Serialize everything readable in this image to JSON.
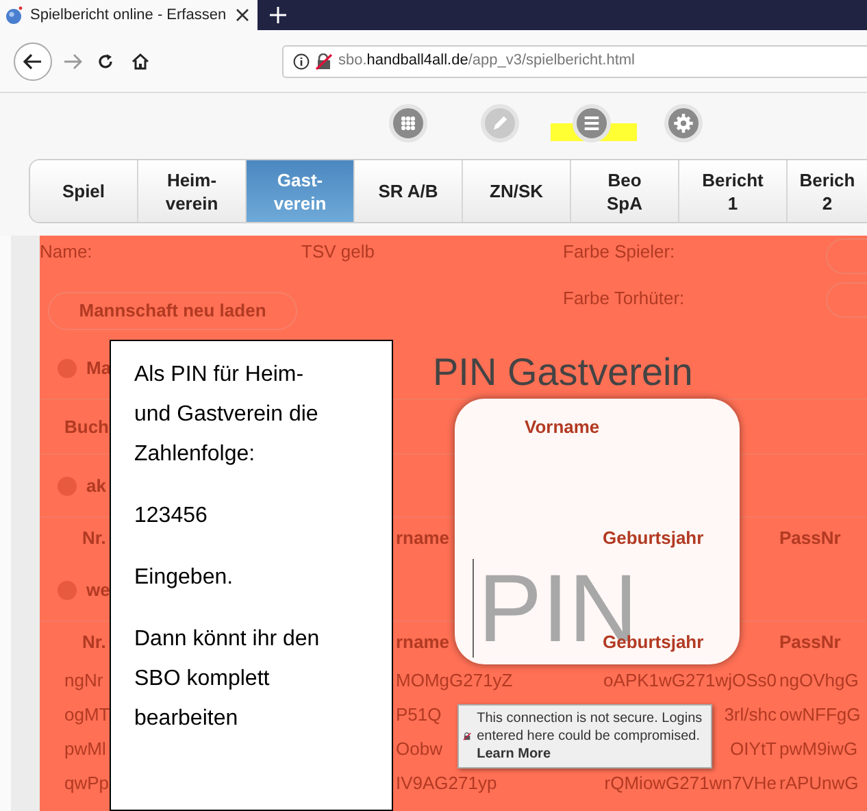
{
  "browser": {
    "tab_title": "Spielbericht online - Erfassen",
    "url": "sbo.**handball4all.de**/app_v3/spielbericht.html"
  },
  "toolbar": [
    {
      "kind": "grid",
      "disabled": false,
      "highlighted": false
    },
    {
      "kind": "pencil",
      "disabled": true,
      "highlighted": false
    },
    {
      "kind": "list",
      "disabled": false,
      "highlighted": true
    },
    {
      "kind": "gear",
      "disabled": false,
      "highlighted": false
    }
  ],
  "tabs": [
    {
      "label": "Spiel",
      "selected": false
    },
    {
      "label": "Heim-\nverein",
      "selected": false
    },
    {
      "label": "Gast-\nverein",
      "selected": true
    },
    {
      "label": "SR A/B",
      "selected": false
    },
    {
      "label": "ZN/SK",
      "selected": false
    },
    {
      "label": "Beo\nSpA",
      "selected": false
    },
    {
      "label": "Bericht\n1",
      "selected": false
    },
    {
      "label": "Berich\n2",
      "selected": false
    }
  ],
  "form": {
    "name_label": "Name:",
    "name_value": "TSV gelb",
    "player_color_label": "Farbe Spieler:",
    "keeper_color_label": "Farbe Torhüter:",
    "reload_button": "Mannschaft neu laden"
  },
  "list": [
    {
      "kind": "section",
      "title": "Ma"
    },
    {
      "kind": "labels",
      "cells": [
        "Buch",
        "Vorname"
      ]
    },
    {
      "kind": "section",
      "title": "ak"
    },
    {
      "kind": "header",
      "cells": [
        "Nr.",
        "rname",
        "Geburtsjahr",
        "PassNr"
      ]
    },
    {
      "kind": "section",
      "title": "we"
    },
    {
      "kind": "header",
      "cells": [
        "Nr.",
        "rname",
        "Geburtsjahr",
        "PassNr"
      ]
    },
    {
      "kind": "row",
      "cells": [
        "ngNr",
        "MOMgG271yZ",
        "oAPK1wG271wjOSs0",
        "ngOVhgG"
      ]
    },
    {
      "kind": "row",
      "cells": [
        "ogMT",
        "P51Q",
        "3rl/shc",
        "owNFFgG"
      ]
    },
    {
      "kind": "row",
      "cells": [
        "pwMl",
        "Oobw",
        "OIYtT",
        "pwM9iwG"
      ]
    },
    {
      "kind": "row",
      "cells": [
        "qwPp",
        "IV9AG271yp",
        "rQMiowG271wn7VHe",
        "rAPUnwG"
      ]
    }
  ],
  "callout": {
    "paragraphs": [
      "Als PIN für Heim- und Gastverein die Zahlenfolge:",
      "123456",
      "Eingeben.",
      "Dann könnt ihr den SBO komplett bearbeiten"
    ]
  },
  "pin_dialog": {
    "title": "PIN Gastverein",
    "placeholder": "PIN"
  },
  "security_tooltip": {
    "message": "This connection is not secure. Logins entered here could be compromised.",
    "link": "Learn More"
  }
}
